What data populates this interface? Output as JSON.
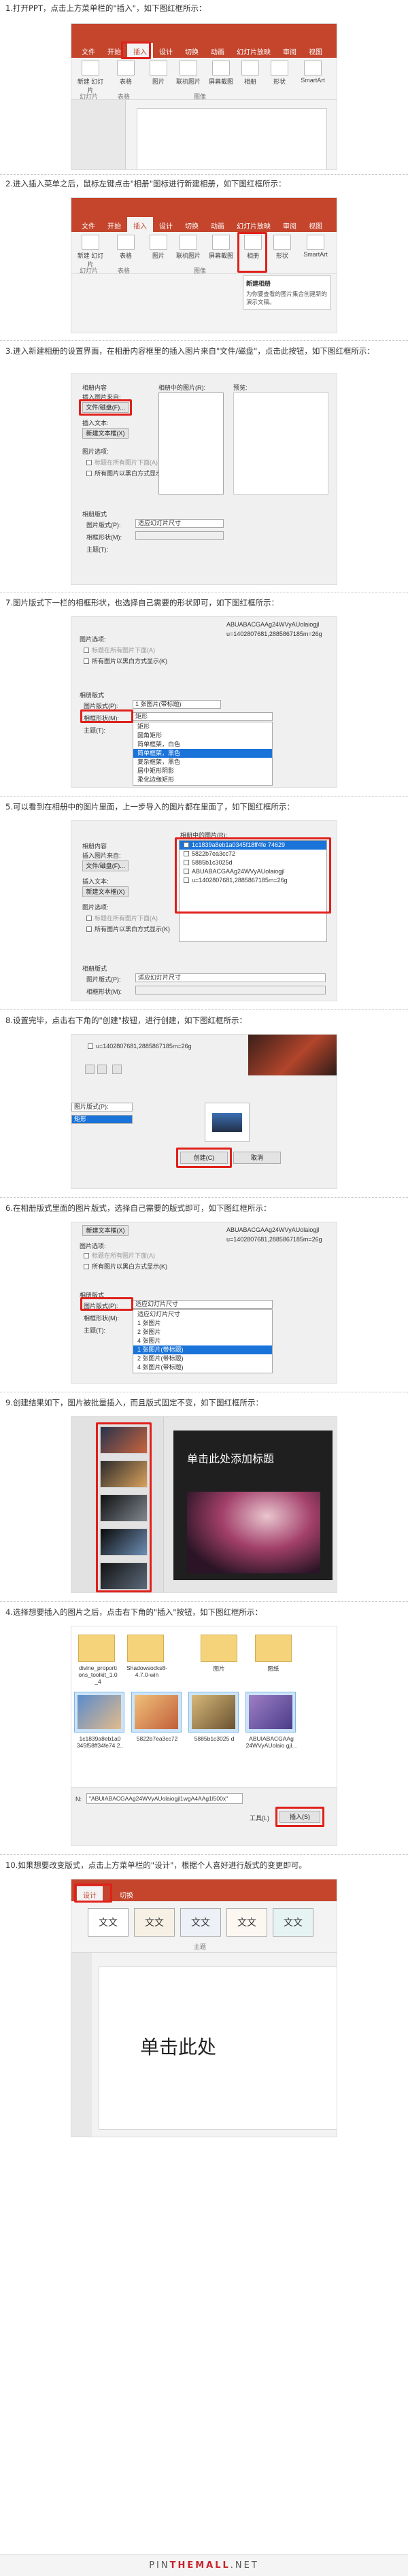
{
  "steps": [
    {
      "caption": "1.打开PPT，点击上方菜单栏的\"插入\"，如下图红框所示："
    },
    {
      "caption": "2.进入插入菜单之后，鼠标左键点击\"相册\"图标进行新建相册，如下图红框所示："
    },
    {
      "caption": "3.进入新建相册的设置界面，在相册内容框里的插入图片来自\"文件/磁盘\"，点击此按钮，如下图红框所示："
    },
    {
      "caption": "7.图片版式下一栏的相框形状，也选择自己需要的形状即可，如下图红框所示："
    },
    {
      "caption": "5.可以看到在相册中的图片里面，上一步导入的图片都在里面了，如下图红框所示："
    },
    {
      "caption": "8.设置完毕，点击右下角的\"创建\"按钮，进行创建，如下图红框所示："
    },
    {
      "caption": "6.在相册版式里面的图片版式，选择自己需要的版式即可，如下图红框所示："
    },
    {
      "caption": "9.创建结果如下，图片被批量插入，而且版式固定不变，如下图红框所示："
    },
    {
      "caption": "4.选择想要插入的图片之后，点击右下角的\"插入\"按钮，如下图红框所示："
    },
    {
      "caption": "10.如果想要改变版式，点击上方菜单栏的\"设计\"，根据个人喜好进行版式的变更即可。"
    }
  ],
  "ppt": {
    "tabs": [
      "文件",
      "开始",
      "插入",
      "设计",
      "切换",
      "动画",
      "幻灯片放映",
      "审阅",
      "视图"
    ],
    "selected_tab": "插入",
    "new_slide": "新建\n幻灯片",
    "table": "表格",
    "images": "图片",
    "online_images": "联机图片",
    "screenshot": "屏幕截图",
    "album": "相册",
    "shapes": "形状",
    "smartart": "SmartArt",
    "group_slides": "幻灯片",
    "group_tables": "表格",
    "group_images": "图像",
    "tooltip_title": "新建相册",
    "tooltip_body": "为你要查看的图片集合创建新的演示文稿。"
  },
  "album": {
    "album_content": "相册内容",
    "insert_from": "插入图片来自:",
    "file_disk": "文件/磁盘(F)...",
    "insert_text": "插入文本:",
    "new_textbox": "新建文本框(X)",
    "picture_options": "图片选项:",
    "caption_below": "标题在所有图片下面(A)",
    "all_bw": "所有图片以黑白方式显示(K)",
    "pictures_in_album": "相册中的图片(R):",
    "preview": "预览:",
    "album_layout": "相册版式",
    "picture_layout": "图片版式(P):",
    "frame_shape": "相框形状(M):",
    "theme": "主题(T):",
    "fit_to_slide": "适应幻灯片尺寸",
    "one_picture_title": "1 张图片(带标题)",
    "shape_value": "矩形",
    "create": "创建(C)",
    "cancel": "取消",
    "file_short": "u=1402807681,2885867185m=26g",
    "files": [
      "1c1839a8eb1a0345f18ff4fe 74629",
      "5822b7ea3cc72",
      "5885b1c3025d",
      "ABUABACGAAg24WVyAUolaiogjl",
      "u=1402807681,2885867185m=26g"
    ],
    "shape_options": [
      "矩形",
      "圆角矩形",
      "简单框架，白色",
      "简单框架，黑色",
      "复杂框架，黑色",
      "居中矩形阴影",
      "柔化边缘矩形"
    ],
    "layout_options": [
      "适应幻灯片尺寸",
      "1 张图片",
      "2 张图片",
      "4 张图片",
      "1 张图片(带标题)",
      "2 张图片(带标题)",
      "4 张图片(带标题)"
    ]
  },
  "result": {
    "slide_title": "单击此处添加标题"
  },
  "insert_dialog": {
    "folders": [
      "divine_proporti ons_toolkit_1.0 _4",
      "Shadowsocks8- 4.7.0-win"
    ],
    "labels": [
      "图片",
      "图纸"
    ],
    "pictures": [
      "1c1839a8eb1a0 345f58ff34fe74 2..",
      "5822b7ea3cc72",
      "5885b1c3025 d",
      "ABUIABACGAAg 24WVyAUolaio gjl..."
    ],
    "filename_label": "N:",
    "filename_value": "\"ABUIABACGAAg24WVyAUolaiogjl1wgA4AAg1l500x\"",
    "tools": "工具(L)",
    "insert": "插入(S)"
  },
  "design": {
    "tabs": [
      "设计",
      "切换"
    ],
    "theme_samples": [
      "文文",
      "文文",
      "文文",
      "文文",
      "文文"
    ],
    "group": "主题",
    "slide_title": "单击此处"
  },
  "footer": {
    "left": "PIN",
    "mid": "THEMALL",
    "right": ".NET"
  }
}
